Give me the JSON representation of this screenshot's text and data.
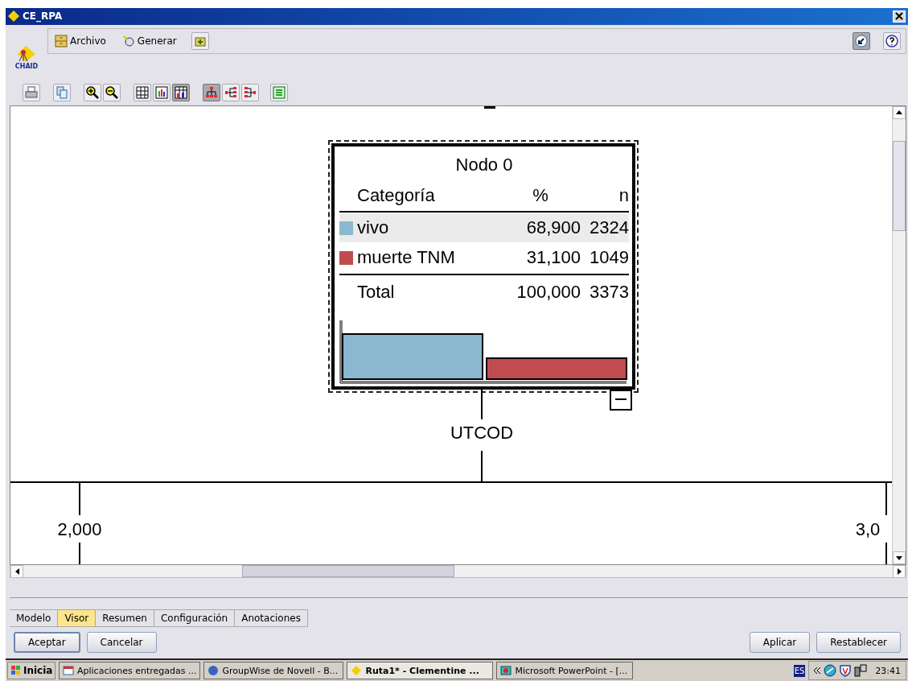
{
  "window": {
    "title": "CE_RPA"
  },
  "logo": {
    "label": "CHAID"
  },
  "menu": [
    {
      "label": "Archivo",
      "kind": "drawer"
    },
    {
      "label": "Generar",
      "kind": "wand"
    }
  ],
  "toolbar": [
    {
      "kind": "print",
      "selected": false
    },
    {
      "kind": "copy",
      "selected": false
    },
    {
      "kind": "zoom-in",
      "selected": false
    },
    {
      "kind": "zoom-out",
      "selected": false
    },
    {
      "kind": "grid",
      "selected": false
    },
    {
      "kind": "chart",
      "selected": false
    },
    {
      "kind": "table-chart",
      "selected": true
    },
    {
      "kind": "tree-down",
      "selected": true
    },
    {
      "kind": "tree-left",
      "selected": false
    },
    {
      "kind": "tree-right",
      "selected": false
    },
    {
      "kind": "export",
      "selected": false
    }
  ],
  "tree": {
    "node": {
      "title": "Nodo 0",
      "columns": [
        "Categoría",
        "%",
        "n"
      ],
      "rows": [
        {
          "category": "vivo",
          "percent": "68,900",
          "n": "2324",
          "color": "#8bb8d0",
          "selected": true
        },
        {
          "category": "muerte TNM",
          "percent": "31,100",
          "n": "1049",
          "color": "#c04c50",
          "selected": false
        }
      ],
      "total": {
        "label": "Total",
        "percent": "100,000",
        "n": "3373"
      }
    },
    "split": "UTCOD",
    "branches": [
      {
        "label": "2,000"
      },
      {
        "label": "3,0"
      }
    ]
  },
  "tabs": [
    {
      "label": "Modelo",
      "selected": false
    },
    {
      "label": "Visor",
      "selected": true
    },
    {
      "label": "Resumen",
      "selected": false
    },
    {
      "label": "Configuración",
      "selected": false
    },
    {
      "label": "Anotaciones",
      "selected": false
    }
  ],
  "buttons_left": [
    {
      "label": "Aceptar",
      "default": true
    },
    {
      "label": "Cancelar",
      "default": false
    }
  ],
  "buttons_right": [
    {
      "label": "Aplicar"
    },
    {
      "label": "Restablecer"
    }
  ],
  "taskbar": {
    "start": "Inicia",
    "tasks": [
      {
        "label": "Aplicaciones entregadas ...",
        "kind": "app",
        "selected": false
      },
      {
        "label": "GroupWise de Novell - B...",
        "kind": "globe",
        "selected": false
      },
      {
        "label": "Ruta1* - Clementine ...",
        "kind": "diamond",
        "selected": true
      },
      {
        "label": "Microsoft PowerPoint - [...",
        "kind": "slides",
        "selected": false
      }
    ],
    "language": "ES",
    "clock": "23:41"
  }
}
